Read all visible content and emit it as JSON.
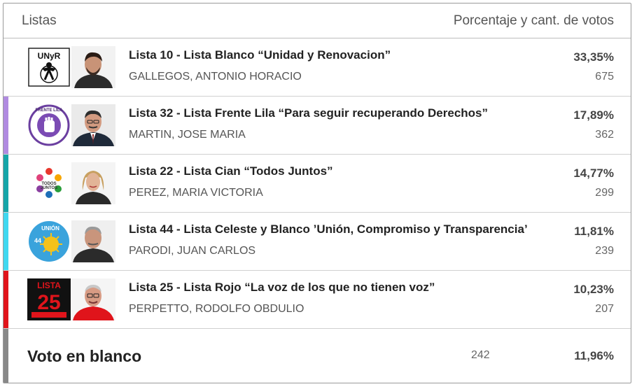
{
  "header": {
    "left_label": "Listas",
    "right_label": "Porcentaje y cant. de votos"
  },
  "lists": [
    {
      "title": "Lista 10 - Lista Blanco “Unidad y Renovacion”",
      "candidate": "GALLEGOS, ANTONIO HORACIO",
      "percent": "33,35%",
      "votes": "675",
      "color": "#ffffff",
      "logo": "unyr-logo",
      "logo_text": "UNyR"
    },
    {
      "title": "Lista 32 - Lista Frente Lila “Para seguir recuperando Derechos”",
      "candidate": "MARTIN, JOSE MARIA",
      "percent": "17,89%",
      "votes": "362",
      "color": "#b08be0",
      "logo": "frente-lila-logo",
      "logo_text": "FRENTE LILA · LISTA 32"
    },
    {
      "title": "Lista 22 - Lista Cian “Todos Juntos”",
      "candidate": "PEREZ, MARIA VICTORIA",
      "percent": "14,77%",
      "votes": "299",
      "color": "#16a5a8",
      "logo": "todos-juntos-logo",
      "logo_text": "TODOS JUNTOS"
    },
    {
      "title": "Lista 44 - Lista Celeste y Blanco ’Unión, Compromiso y Transparencia’",
      "candidate": "PARODI, JUAN CARLOS",
      "percent": "11,81%",
      "votes": "239",
      "color": "#40d8f0",
      "logo": "union-logo",
      "logo_text": "UNIÓN"
    },
    {
      "title": "Lista 25 - Lista Rojo “La voz de los que no tienen voz”",
      "candidate": "PERPETTO, RODOLFO OBDULIO",
      "percent": "10,23%",
      "votes": "207",
      "color": "#e0141b",
      "logo": "lista-25-logo",
      "logo_text": "LISTA 25"
    }
  ],
  "blank_vote": {
    "label": "Voto en blanco",
    "votes": "242",
    "percent": "11,96%",
    "color": "#888888"
  }
}
